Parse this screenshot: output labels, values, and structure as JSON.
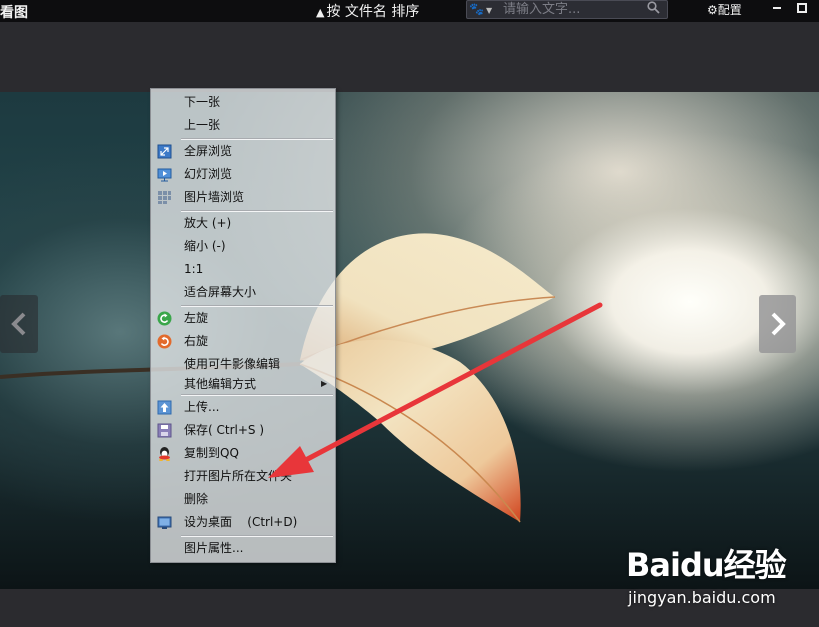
{
  "titlebar": {
    "app_title": "牛看图",
    "sort_label": "按 文件名 排序",
    "search_placeholder": "请输入文字...",
    "config_label": "配置"
  },
  "context_menu": {
    "items": [
      {
        "label": "下一张",
        "icon": null
      },
      {
        "label": "上一张",
        "icon": null
      },
      {
        "label": "全屏浏览",
        "icon": "fullscreen-icon"
      },
      {
        "label": "幻灯浏览",
        "icon": "slideshow-icon"
      },
      {
        "label": "图片墙浏览",
        "icon": "photo-wall-icon"
      },
      {
        "label": "放大 (+)",
        "icon": null
      },
      {
        "label": "缩小 (-)",
        "icon": null
      },
      {
        "label": "1:1",
        "icon": null
      },
      {
        "label": "适合屏幕大小",
        "icon": null
      },
      {
        "label": "左旋",
        "icon": "rotate-left-icon"
      },
      {
        "label": "右旋",
        "icon": "rotate-right-icon"
      },
      {
        "label": "使用可牛影像编辑",
        "icon": null
      },
      {
        "label": "其他编辑方式",
        "icon": null,
        "submenu": true
      },
      {
        "label": "上传...",
        "icon": "upload-icon"
      },
      {
        "label": "保存( Ctrl+S )",
        "icon": "save-icon"
      },
      {
        "label": "复制到QQ",
        "icon": "qq-icon"
      },
      {
        "label": "打开图片所在文件夹",
        "icon": null
      },
      {
        "label": "删除",
        "icon": null
      },
      {
        "label": "设为桌面    (Ctrl+D)",
        "icon": "desktop-icon"
      },
      {
        "label": "图片属性...",
        "icon": null
      }
    ]
  },
  "watermark": {
    "logo": "Baidu经验",
    "url": "jingyan.baidu.com"
  },
  "colors": {
    "titlebar_bg": "#0d0d0f",
    "app_bg": "#2b2b2f",
    "menu_bg": "#e8eaec",
    "arrow_red": "#e8363a"
  }
}
